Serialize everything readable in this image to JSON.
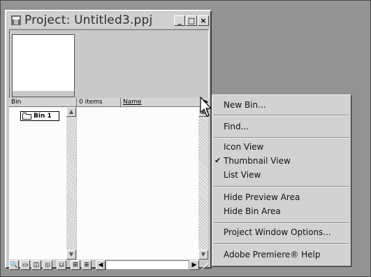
{
  "window": {
    "title": "Project: Untitled3.ppj",
    "controls": {
      "minimize": "_",
      "maximize": "□",
      "close": "×"
    }
  },
  "columns": {
    "bin": "Bin",
    "count": "0 items",
    "name": "Name"
  },
  "bins": [
    {
      "label": "Bin 1"
    }
  ],
  "toolbar": {
    "buttons": [
      {
        "icon": "binoculars-icon",
        "glyph": "🔍"
      },
      {
        "icon": "new-bin-icon",
        "glyph": "▭"
      },
      {
        "icon": "new-item-icon",
        "glyph": "◫"
      },
      {
        "icon": "split-icon",
        "glyph": "⟨|⟩"
      },
      {
        "icon": "delete-icon",
        "glyph": "⊔"
      },
      {
        "icon": "thumbnail-view-icon",
        "glyph": "⊞"
      },
      {
        "icon": "list-view-icon",
        "glyph": "≣"
      }
    ]
  },
  "menu": {
    "items": [
      {
        "label": "New Bin...",
        "checked": false
      },
      {
        "label": "Find...",
        "checked": false
      },
      {
        "label": "Icon View",
        "checked": false
      },
      {
        "label": "Thumbnail View",
        "checked": true
      },
      {
        "label": "List View",
        "checked": false
      },
      {
        "label": "Hide Preview Area",
        "checked": false
      },
      {
        "label": "Hide Bin Area",
        "checked": false
      },
      {
        "label": "Project Window Options...",
        "checked": false
      },
      {
        "label": "Adobe Premiere® Help",
        "checked": false
      }
    ],
    "check_glyph": "✔"
  }
}
